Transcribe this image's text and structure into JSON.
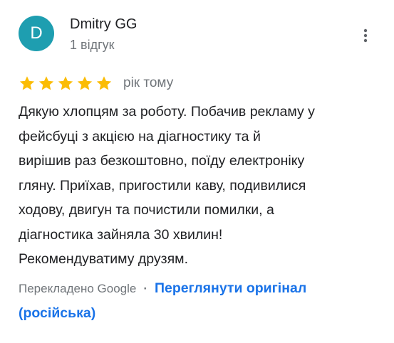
{
  "author": {
    "avatar_letter": "D",
    "name": "Dmitry GG",
    "review_count": "1 відгук"
  },
  "more_button": {
    "icon": "more-vert-icon"
  },
  "rating": {
    "stars": 5,
    "max_stars": 5,
    "star_color": "#fbbc04",
    "time": "рік тому"
  },
  "review": {
    "lines": [
      "Дякую хлопцям за роботу. Побачив рекламу у",
      "фейсбуці з акцією на діагностику та й",
      "вирішив раз безкоштовно, поїду електроніку",
      "гляну. Приїхав, пригостили каву, подивилися",
      "ходову, двигун та почистили помилки, а",
      "діагностика зайняла 30 хвилин!",
      "Рекомендуватиму друзям."
    ]
  },
  "translation": {
    "note": "Перекладено Google",
    "separator": "·",
    "link_line1": "Переглянути оригінал",
    "link_line2": "(російська)"
  },
  "colors": {
    "avatar_bg": "#1e9eb0",
    "link": "#1a73e8",
    "secondary_text": "#70757a",
    "primary_text": "#202124"
  }
}
